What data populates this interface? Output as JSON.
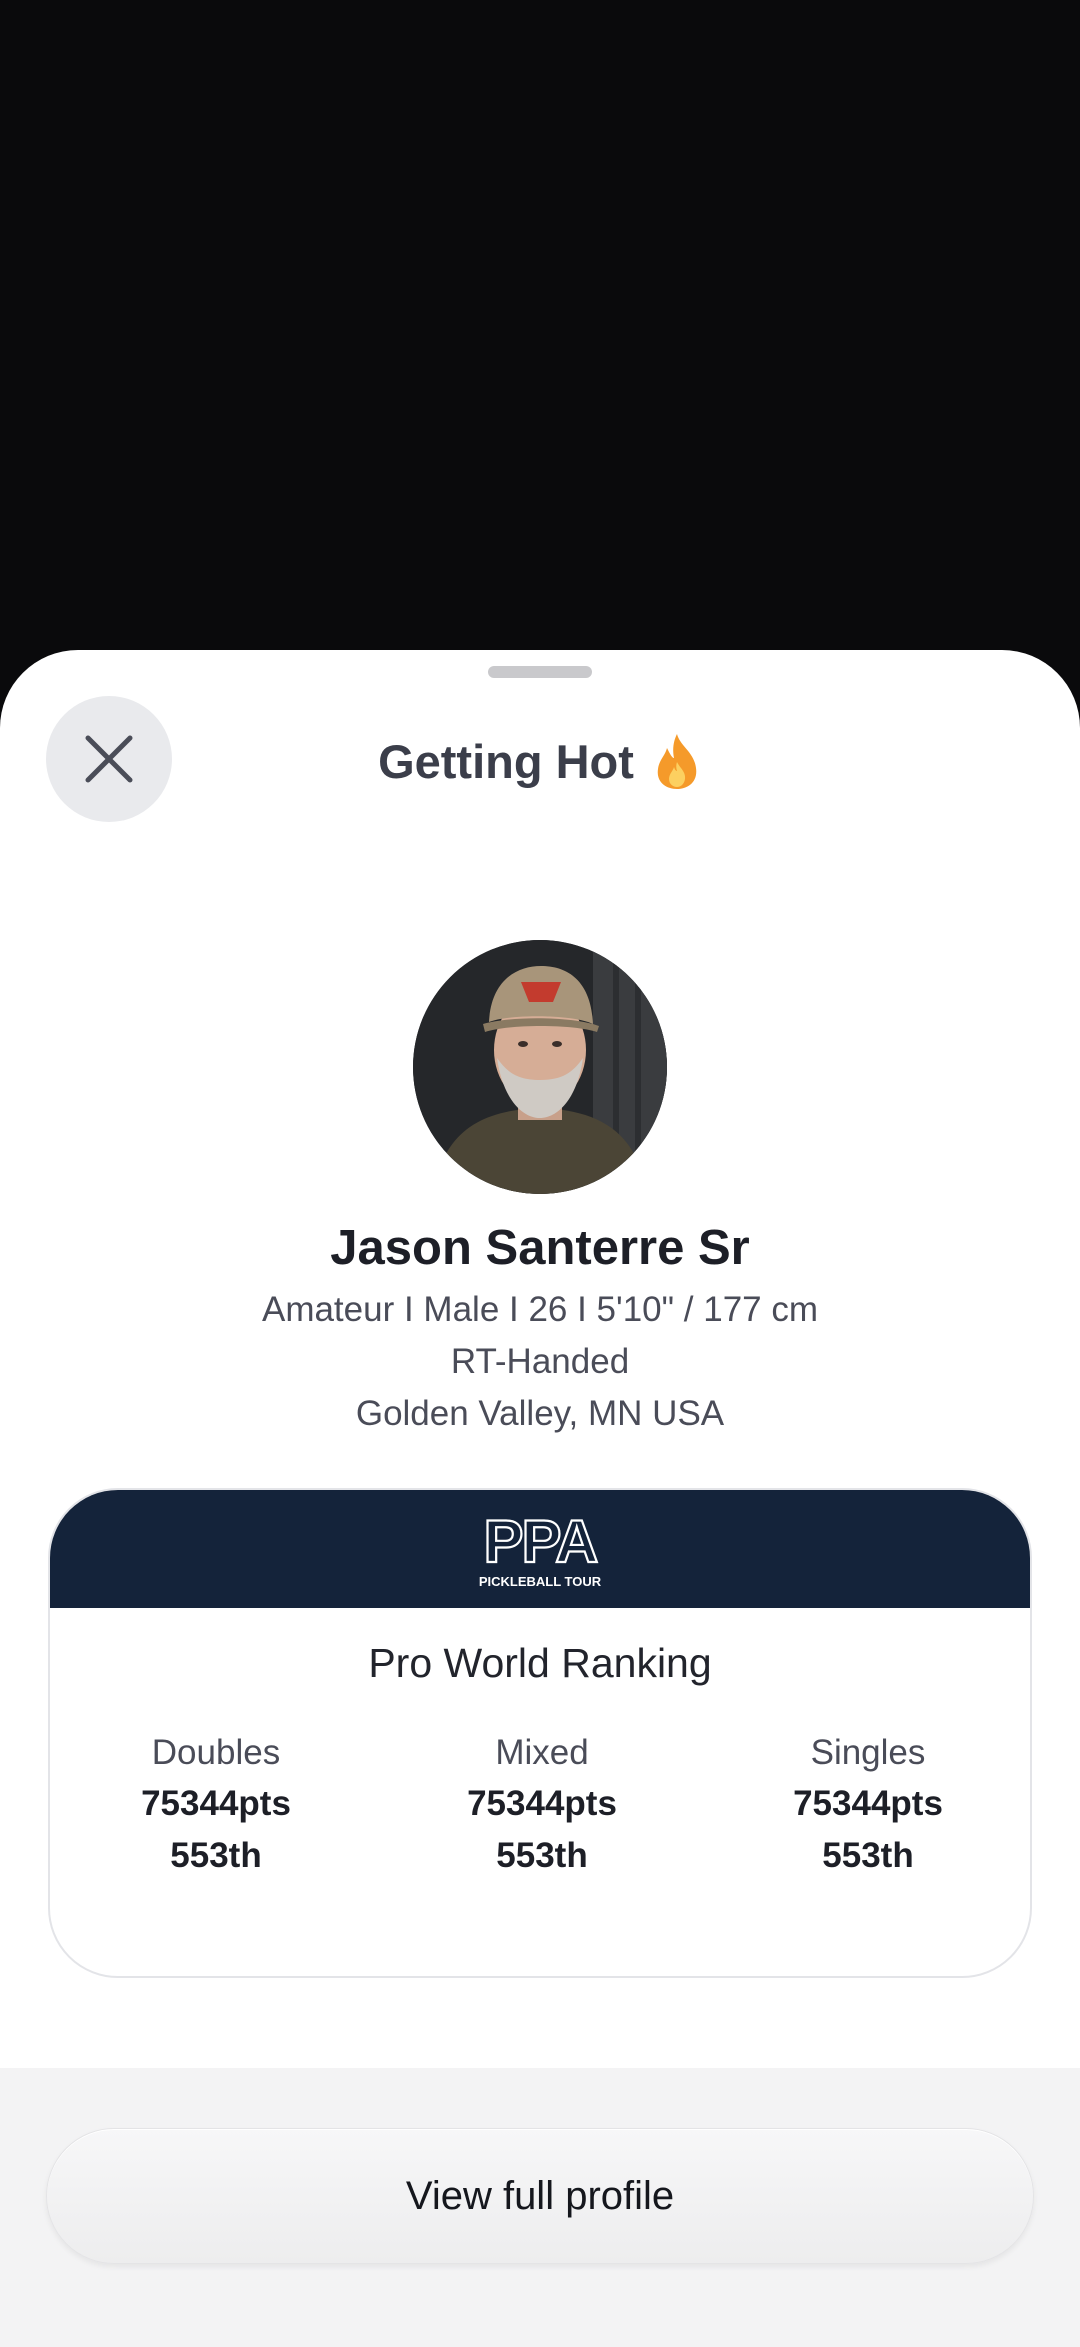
{
  "sheet": {
    "title": "Getting Hot",
    "title_icon": "flame-icon",
    "close_icon": "close-icon"
  },
  "player": {
    "name": "Jason Santerre Sr",
    "details": "Amateur I Male I 26 I 5'10\" / 177 cm",
    "handedness": "RT-Handed",
    "location": "Golden Valley, MN USA"
  },
  "ranking": {
    "logo_text": "PPA",
    "logo_subtitle": "PICKLEBALL TOUR",
    "title": "Pro World Ranking",
    "columns": [
      {
        "label": "Doubles",
        "points": "75344pts",
        "rank": "553th"
      },
      {
        "label": "Mixed",
        "points": "75344pts",
        "rank": "553th"
      },
      {
        "label": "Singles",
        "points": "75344pts",
        "rank": "553th"
      }
    ]
  },
  "footer": {
    "button_label": "View full profile"
  },
  "colors": {
    "backdrop": "#0a0a0c",
    "ppa_header": "#14233a",
    "flame": "#f59a2a"
  }
}
